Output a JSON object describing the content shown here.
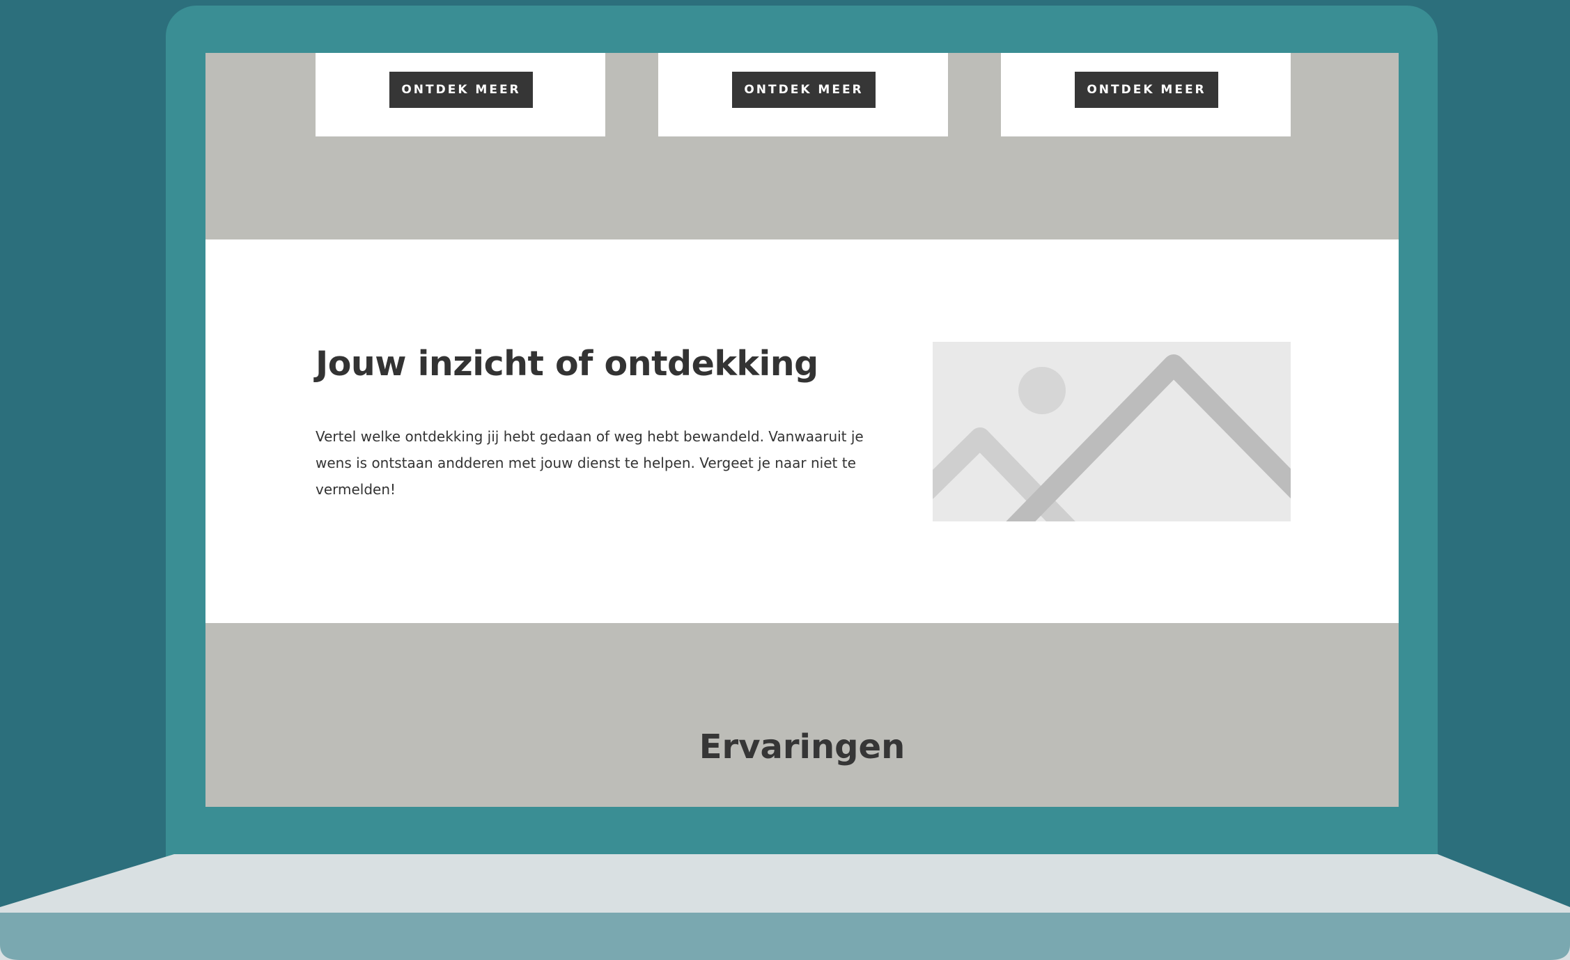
{
  "cards": [
    {
      "button_label": "ONTDEK MEER"
    },
    {
      "button_label": "ONTDEK MEER"
    },
    {
      "button_label": "ONTDEK MEER"
    }
  ],
  "feature": {
    "title": "Jouw inzicht of ontdekking",
    "body": "Vertel welke ontdekking jij hebt gedaan of weg hebt bewandeld. Vanwaaruit je wens is ontstaan andderen met jouw dienst te helpen. Vergeet je naar niet te vermelden!",
    "image_icon": "image-placeholder-icon"
  },
  "testimonials": {
    "title": "Ervaringen"
  },
  "colors": {
    "background": "#2c6f7c",
    "laptop_frame": "#3a8e94",
    "band_gray": "#bdbdb8",
    "button_dark": "#363636",
    "base_light": "#d9e0e2",
    "base_dark": "#7aa8b0"
  }
}
